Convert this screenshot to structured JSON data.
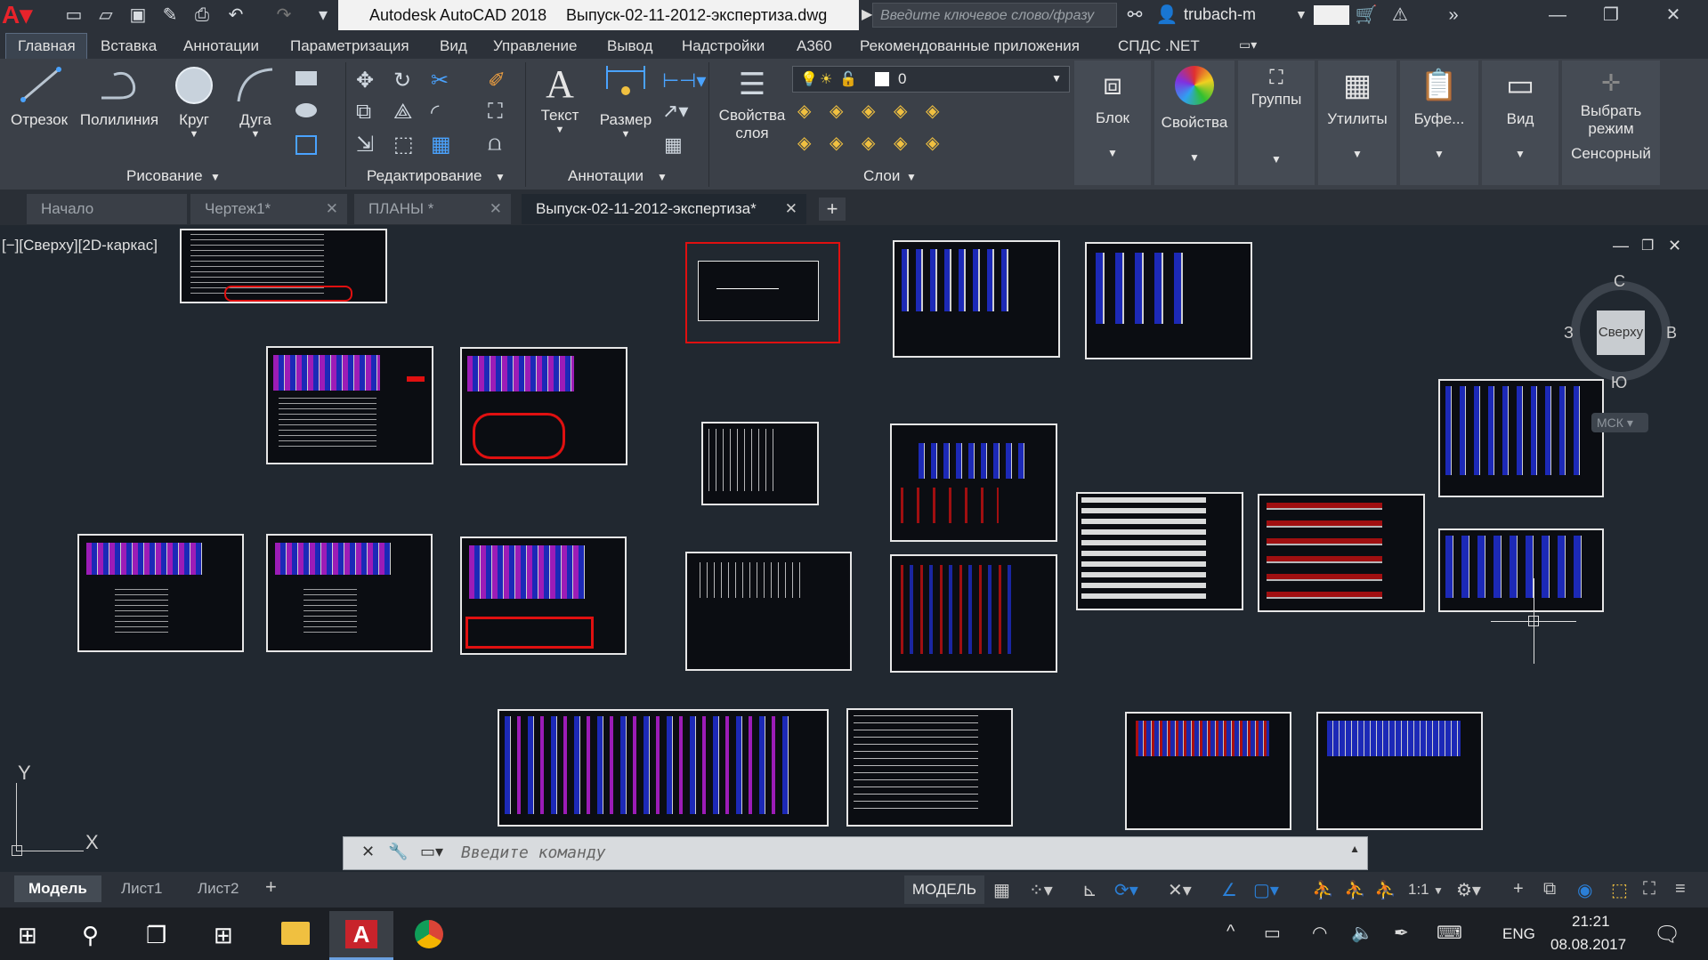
{
  "window": {
    "app_title": "Autodesk AutoCAD 2018",
    "file_title": "Выпуск-02-11-2012-экспертиза.dwg",
    "search_placeholder": "Введите ключевое слово/фразу",
    "user": "trubach-m"
  },
  "menu_tabs": [
    "Главная",
    "Вставка",
    "Аннотации",
    "Параметризация",
    "Вид",
    "Управление",
    "Вывод",
    "Надстройки",
    "A360",
    "Рекомендованные приложения",
    "СПДС .NET"
  ],
  "ribbon": {
    "draw": {
      "title": "Рисование",
      "tools": [
        "Отрезок",
        "Полилиния",
        "Круг",
        "Дуга"
      ]
    },
    "modify": {
      "title": "Редактирование"
    },
    "annotation": {
      "title": "Аннотации",
      "tools": [
        "Текст",
        "Размер"
      ]
    },
    "layers": {
      "title": "Слои",
      "tool_line1": "Свойства",
      "tool_line2": "слоя",
      "current_layer": "0"
    },
    "panels": [
      "Блок",
      "Свойства",
      "Группы",
      "Утилиты",
      "Буфе...",
      "Вид"
    ],
    "touch_line1": "Выбрать",
    "touch_line2": "режим",
    "touch_title": "Сенсорный"
  },
  "doc_tabs": [
    "Начало",
    "Чертеж1*",
    "ПЛАНЫ *",
    "Выпуск-02-11-2012-экспертиза*"
  ],
  "viewport": {
    "label": "[−][Сверху][2D-каркас]",
    "viewcube": {
      "face": "Сверху",
      "n": "С",
      "s": "Ю",
      "w": "З",
      "e": "В",
      "ucs": "МСК"
    },
    "axis_y": "Y",
    "axis_x": "X"
  },
  "command_placeholder": "Введите команду",
  "layout_tabs": [
    "Модель",
    "Лист1",
    "Лист2"
  ],
  "status": {
    "mode": "МОДЕЛЬ",
    "scale": "1:1"
  },
  "taskbar": {
    "lang": "ENG",
    "time": "21:21",
    "date": "08.08.2017"
  },
  "colors": {
    "accent": "#2b7fd6",
    "sheet_bg": "#0b0d12",
    "canvas": "#212830",
    "highlight": "#e01010"
  }
}
